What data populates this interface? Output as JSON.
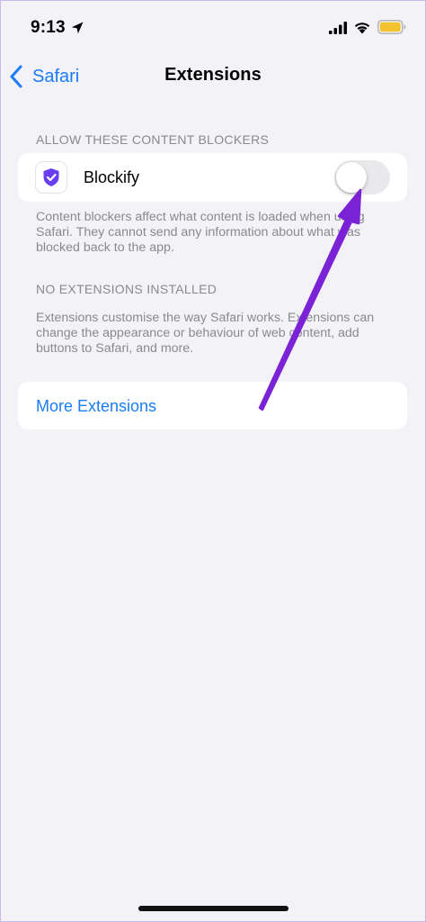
{
  "status_bar": {
    "time": "9:13",
    "icons": [
      "location-arrow-icon",
      "signal-bars-icon",
      "wifi-icon",
      "battery-icon"
    ],
    "battery_color": "#f4c430"
  },
  "nav": {
    "back_label": "Safari",
    "title": "Extensions"
  },
  "content_blockers": {
    "header": "ALLOW THESE CONTENT BLOCKERS",
    "items": [
      {
        "label": "Blockify",
        "icon": "shield-check-icon",
        "icon_color": "#6a3df0",
        "enabled": false
      }
    ],
    "footer": "Content blockers affect what content is loaded when using Safari. They cannot send any information about what was blocked back to the app."
  },
  "extensions": {
    "header": "NO EXTENSIONS INSTALLED",
    "footer": "Extensions customise the way Safari works. Extensions can change the appearance or behaviour of web content, add buttons to Safari, and more."
  },
  "more_extensions": {
    "label": "More Extensions"
  },
  "colors": {
    "accent": "#1a7cf5",
    "background": "#f2f2f7",
    "annotation": "#7b22d6"
  }
}
